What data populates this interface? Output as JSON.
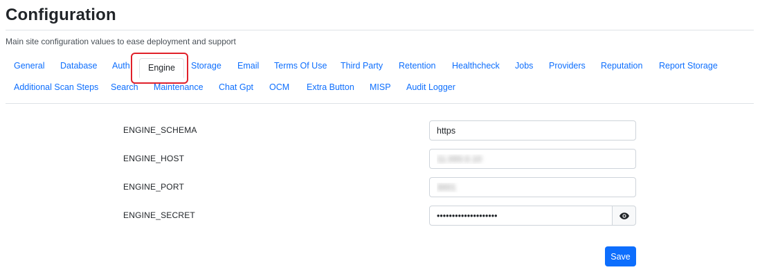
{
  "page": {
    "title": "Configuration",
    "subtitle": "Main site configuration values to ease deployment and support"
  },
  "tabs": {
    "row1": [
      {
        "label": "General"
      },
      {
        "label": "Database"
      },
      {
        "label": "Auth"
      },
      {
        "label": "Engine",
        "active": true
      },
      {
        "label": "Storage"
      },
      {
        "label": "Email"
      },
      {
        "label": "Terms Of Use"
      },
      {
        "label": "Third Party"
      },
      {
        "label": "Retention"
      },
      {
        "label": "Healthcheck"
      },
      {
        "label": "Jobs"
      },
      {
        "label": "Providers"
      },
      {
        "label": "Reputation"
      },
      {
        "label": "Report Storage"
      }
    ],
    "row2": [
      {
        "label": "Additional Scan Steps"
      },
      {
        "label": "Search"
      },
      {
        "label": "Maintenance"
      },
      {
        "label": "Chat Gpt"
      },
      {
        "label": "OCM"
      },
      {
        "label": "Extra Button"
      },
      {
        "label": "MISP"
      },
      {
        "label": "Audit Logger"
      }
    ]
  },
  "form": {
    "fields": [
      {
        "label": "ENGINE_SCHEMA",
        "value": "https"
      },
      {
        "label": "ENGINE_HOST",
        "value": "11.000.0.10"
      },
      {
        "label": "ENGINE_PORT",
        "value": "3001"
      },
      {
        "label": "ENGINE_SECRET",
        "value": "••••••••••••••••••••"
      }
    ],
    "save_label": "Save"
  },
  "icons": {
    "password_toggle": "eye-icon"
  },
  "colors": {
    "link": "#0d6efd",
    "primary_button": "#0d6efd",
    "highlight_box": "#e0202a"
  }
}
